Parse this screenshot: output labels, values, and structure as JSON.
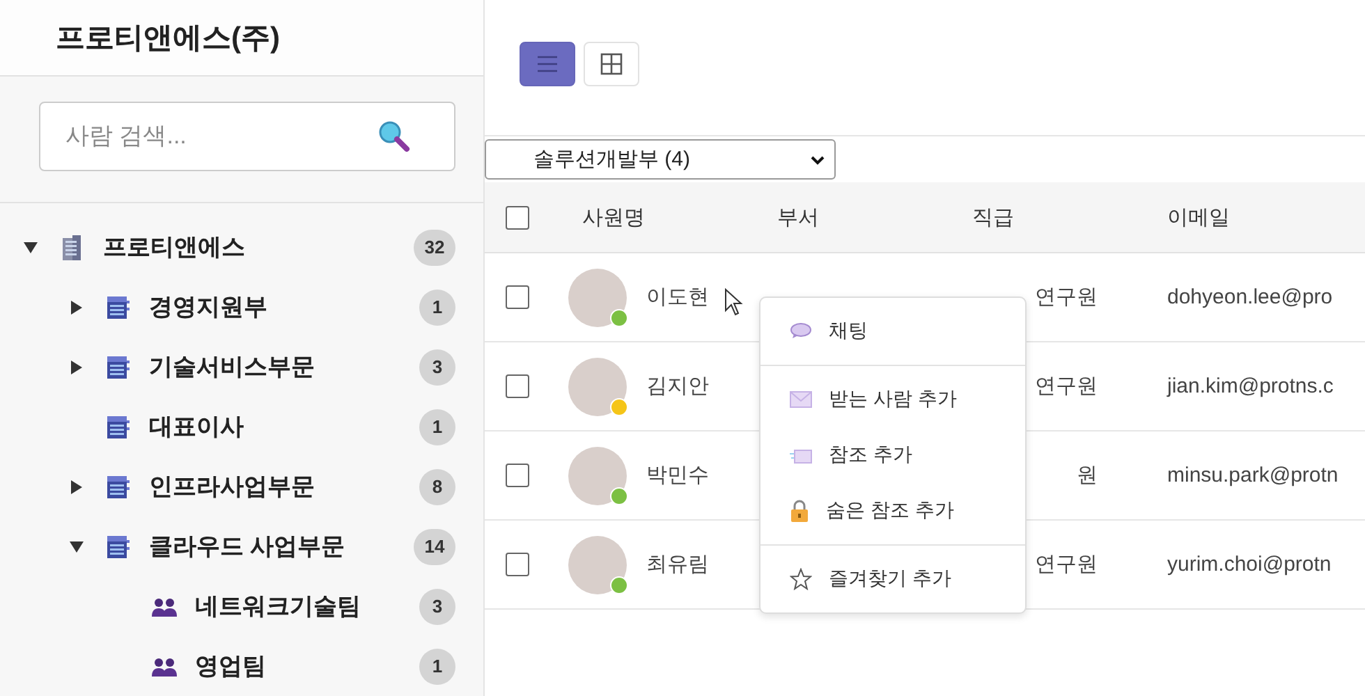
{
  "sidebar": {
    "title": "프로티앤에스(주)",
    "search": {
      "placeholder": "사람 검색..."
    },
    "tree": [
      {
        "label": "프로티앤에스",
        "count": "32",
        "kind": "company",
        "expanded": true,
        "children": [
          {
            "label": "경영지원부",
            "count": "1",
            "kind": "department",
            "expanded": false
          },
          {
            "label": "기술서비스부문",
            "count": "3",
            "kind": "department",
            "expanded": false
          },
          {
            "label": "대표이사",
            "count": "1",
            "kind": "department"
          },
          {
            "label": "인프라사업부문",
            "count": "8",
            "kind": "department",
            "expanded": false
          },
          {
            "label": "클라우드 사업부문",
            "count": "14",
            "kind": "department",
            "expanded": true,
            "children": [
              {
                "label": "네트워크기술팀",
                "count": "3",
                "kind": "team"
              },
              {
                "label": "영업팀",
                "count": "1",
                "kind": "team"
              }
            ]
          }
        ]
      }
    ]
  },
  "view_buttons": [
    {
      "kind": "list",
      "selected": true
    },
    {
      "kind": "grid",
      "selected": false
    }
  ],
  "department_select": {
    "value": "솔루션개발부 (4)"
  },
  "table": {
    "select_all": {
      "checked": false
    },
    "columns": [
      "사원명",
      "부서",
      "직급",
      "이메일"
    ],
    "rows": [
      {
        "checked": false,
        "name": "이도현",
        "color": "#7cc043",
        "rank": "연구원",
        "email": "dohyeon.lee@pro"
      },
      {
        "checked": false,
        "name": "김지안",
        "color": "#f5c518",
        "rank": "연구원",
        "email": "jian.kim@protns.c"
      },
      {
        "checked": false,
        "name": "박민수",
        "color": "#7cc043",
        "rank": "원",
        "email": "minsu.park@protn"
      },
      {
        "checked": false,
        "name": "최유림",
        "color": "#7cc043",
        "rank": "연구원",
        "email": "yurim.choi@protn"
      }
    ]
  },
  "context_menu": {
    "groups": [
      [
        {
          "kind": "chat",
          "label": "채팅"
        }
      ],
      [
        {
          "kind": "mail",
          "label": "받는 사람 추가"
        },
        {
          "kind": "cc",
          "label": "참조 추가"
        },
        {
          "kind": "lock",
          "label": "숨은 참조 추가"
        }
      ],
      [
        {
          "kind": "star",
          "label": "즐겨찾기 추가"
        }
      ]
    ]
  }
}
